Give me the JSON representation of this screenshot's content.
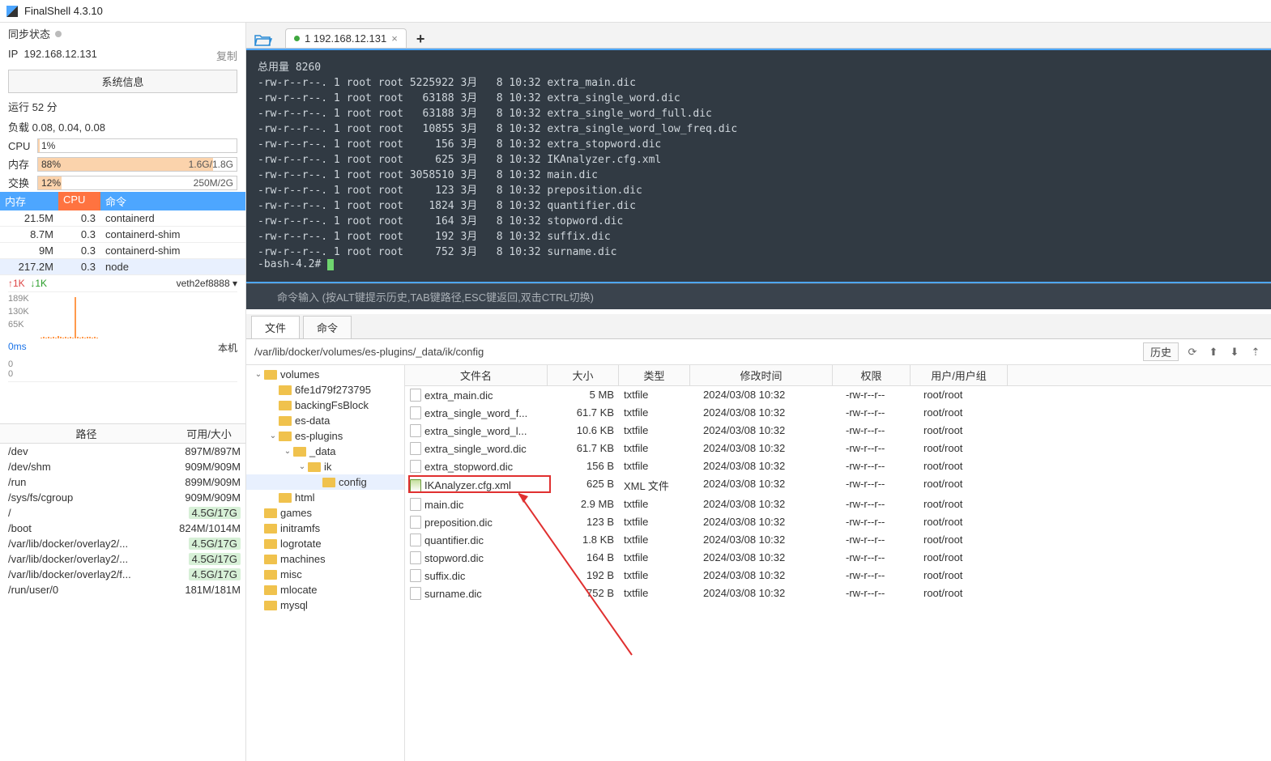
{
  "app": {
    "title": "FinalShell 4.3.10"
  },
  "sidebar": {
    "sync_status": "同步状态",
    "ip_label": "IP",
    "ip": "192.168.12.131",
    "copy": "复制",
    "sysinfo_btn": "系统信息",
    "runtime": "运行 52 分",
    "load": "负载 0.08, 0.04, 0.08",
    "cpu_label": "CPU",
    "cpu_pct": "1%",
    "mem_label": "内存",
    "mem_pct": "88%",
    "mem_text": "1.6G/1.8G",
    "swap_label": "交换",
    "swap_pct": "12%",
    "swap_text": "250M/2G",
    "proc_head": {
      "mem": "内存",
      "cpu": "CPU",
      "cmd": "命令"
    },
    "procs": [
      {
        "mem": "21.5M",
        "cpu": "0.3",
        "cmd": "containerd"
      },
      {
        "mem": "8.7M",
        "cpu": "0.3",
        "cmd": "containerd-shim"
      },
      {
        "mem": "9M",
        "cpu": "0.3",
        "cmd": "containerd-shim"
      },
      {
        "mem": "217.2M",
        "cpu": "0.3",
        "cmd": "node"
      }
    ],
    "net": {
      "up": "↑1K",
      "dn": "↓1K",
      "iface": "veth2ef8888 ▾",
      "y0": "189K",
      "y1": "130K",
      "y2": "65K"
    },
    "ping": {
      "lbl": "0ms",
      "v0": "0",
      "v1": "0",
      "host": "本机"
    },
    "disk_head": {
      "path": "路径",
      "avail": "可用/大小"
    },
    "disks": [
      {
        "path": "/dev",
        "val": "897M/897M"
      },
      {
        "path": "/dev/shm",
        "val": "909M/909M"
      },
      {
        "path": "/run",
        "val": "899M/909M"
      },
      {
        "path": "/sys/fs/cgroup",
        "val": "909M/909M"
      },
      {
        "path": "/",
        "val": "4.5G/17G",
        "hl": true
      },
      {
        "path": "/boot",
        "val": "824M/1014M"
      },
      {
        "path": "/var/lib/docker/overlay2/...",
        "val": "4.5G/17G",
        "hl": true
      },
      {
        "path": "/var/lib/docker/overlay2/...",
        "val": "4.5G/17G",
        "hl": true
      },
      {
        "path": "/var/lib/docker/overlay2/f...",
        "val": "4.5G/17G",
        "hl": true
      },
      {
        "path": "/run/user/0",
        "val": "181M/181M"
      }
    ]
  },
  "tab": {
    "label": "1 192.168.12.131"
  },
  "terminal_lines": [
    "总用量 8260",
    "-rw-r--r--. 1 root root 5225922 3月   8 10:32 extra_main.dic",
    "-rw-r--r--. 1 root root   63188 3月   8 10:32 extra_single_word.dic",
    "-rw-r--r--. 1 root root   63188 3月   8 10:32 extra_single_word_full.dic",
    "-rw-r--r--. 1 root root   10855 3月   8 10:32 extra_single_word_low_freq.dic",
    "-rw-r--r--. 1 root root     156 3月   8 10:32 extra_stopword.dic",
    "-rw-r--r--. 1 root root     625 3月   8 10:32 IKAnalyzer.cfg.xml",
    "-rw-r--r--. 1 root root 3058510 3月   8 10:32 main.dic",
    "-rw-r--r--. 1 root root     123 3月   8 10:32 preposition.dic",
    "-rw-r--r--. 1 root root    1824 3月   8 10:32 quantifier.dic",
    "-rw-r--r--. 1 root root     164 3月   8 10:32 stopword.dic",
    "-rw-r--r--. 1 root root     192 3月   8 10:32 suffix.dic",
    "-rw-r--r--. 1 root root     752 3月   8 10:32 surname.dic",
    "-bash-4.2# "
  ],
  "cmd_hint": "命令输入 (按ALT键提示历史,TAB键路径,ESC键返回,双击CTRL切换)",
  "bottom_tabs": {
    "files": "文件",
    "cmds": "命令"
  },
  "path": "/var/lib/docker/volumes/es-plugins/_data/ik/config",
  "history_btn": "历史",
  "tree": [
    {
      "name": "volumes",
      "depth": 0,
      "exp": true
    },
    {
      "name": "6fe1d79f273795",
      "depth": 1
    },
    {
      "name": "backingFsBlock",
      "depth": 1
    },
    {
      "name": "es-data",
      "depth": 1
    },
    {
      "name": "es-plugins",
      "depth": 1,
      "exp": true
    },
    {
      "name": "_data",
      "depth": 2,
      "exp": true
    },
    {
      "name": "ik",
      "depth": 3,
      "exp": true
    },
    {
      "name": "config",
      "depth": 4,
      "sel": true
    },
    {
      "name": "html",
      "depth": 1
    },
    {
      "name": "games",
      "depth": 0
    },
    {
      "name": "initramfs",
      "depth": 0
    },
    {
      "name": "logrotate",
      "depth": 0
    },
    {
      "name": "machines",
      "depth": 0
    },
    {
      "name": "misc",
      "depth": 0
    },
    {
      "name": "mlocate",
      "depth": 0
    },
    {
      "name": "mysql",
      "depth": 0
    }
  ],
  "fl_head": {
    "name": "文件名",
    "size": "大小",
    "type": "类型",
    "date": "修改时间",
    "perm": "权限",
    "user": "用户/用户组"
  },
  "files": [
    {
      "name": "extra_main.dic",
      "size": "5 MB",
      "type": "txtfile",
      "date": "2024/03/08 10:32",
      "perm": "-rw-r--r--",
      "user": "root/root"
    },
    {
      "name": "extra_single_word_f...",
      "size": "61.7 KB",
      "type": "txtfile",
      "date": "2024/03/08 10:32",
      "perm": "-rw-r--r--",
      "user": "root/root"
    },
    {
      "name": "extra_single_word_l...",
      "size": "10.6 KB",
      "type": "txtfile",
      "date": "2024/03/08 10:32",
      "perm": "-rw-r--r--",
      "user": "root/root"
    },
    {
      "name": "extra_single_word.dic",
      "size": "61.7 KB",
      "type": "txtfile",
      "date": "2024/03/08 10:32",
      "perm": "-rw-r--r--",
      "user": "root/root"
    },
    {
      "name": "extra_stopword.dic",
      "size": "156 B",
      "type": "txtfile",
      "date": "2024/03/08 10:32",
      "perm": "-rw-r--r--",
      "user": "root/root"
    },
    {
      "name": "IKAnalyzer.cfg.xml",
      "size": "625 B",
      "type": "XML 文件",
      "date": "2024/03/08 10:32",
      "perm": "-rw-r--r--",
      "user": "root/root",
      "xml": true,
      "highlight": true
    },
    {
      "name": "main.dic",
      "size": "2.9 MB",
      "type": "txtfile",
      "date": "2024/03/08 10:32",
      "perm": "-rw-r--r--",
      "user": "root/root"
    },
    {
      "name": "preposition.dic",
      "size": "123 B",
      "type": "txtfile",
      "date": "2024/03/08 10:32",
      "perm": "-rw-r--r--",
      "user": "root/root"
    },
    {
      "name": "quantifier.dic",
      "size": "1.8 KB",
      "type": "txtfile",
      "date": "2024/03/08 10:32",
      "perm": "-rw-r--r--",
      "user": "root/root"
    },
    {
      "name": "stopword.dic",
      "size": "164 B",
      "type": "txtfile",
      "date": "2024/03/08 10:32",
      "perm": "-rw-r--r--",
      "user": "root/root"
    },
    {
      "name": "suffix.dic",
      "size": "192 B",
      "type": "txtfile",
      "date": "2024/03/08 10:32",
      "perm": "-rw-r--r--",
      "user": "root/root"
    },
    {
      "name": "surname.dic",
      "size": "752 B",
      "type": "txtfile",
      "date": "2024/03/08 10:32",
      "perm": "-rw-r--r--",
      "user": "root/root"
    }
  ]
}
